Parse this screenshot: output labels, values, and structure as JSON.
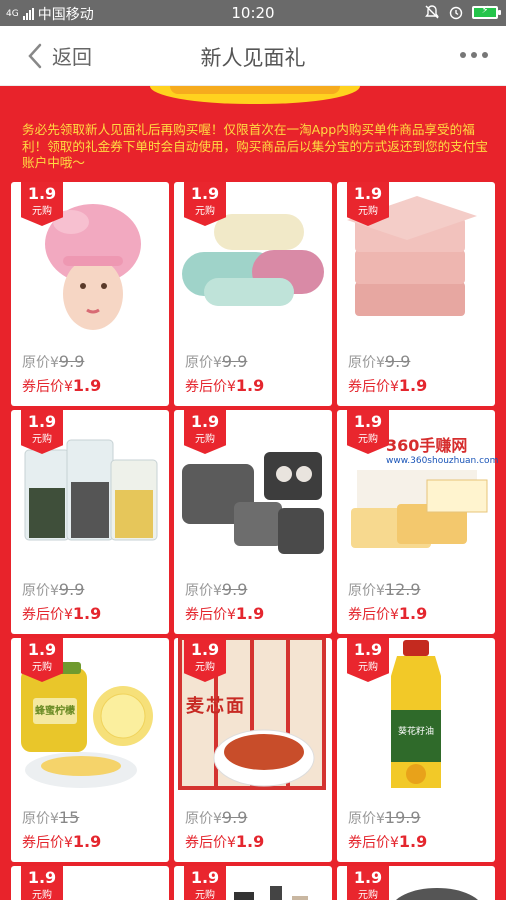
{
  "status": {
    "carrier": "中国移动",
    "time": "10:20",
    "net_label": "4G",
    "battery_icon": "battery-charging-icon"
  },
  "nav": {
    "back_label": "返回",
    "title": "新人见面礼",
    "more_icon": "more-dots-icon"
  },
  "notice": "务必先领取新人见面礼后再购买喔！仅限首次在一淘App内购买单件商品享受的福利！领取的礼金券下单时会自动使用，购买商品后以集分宝的方式返还到您的支付宝账户中哦～",
  "labels": {
    "orig_prefix": "原价¥",
    "now_prefix": "券后价¥",
    "badge_unit": "元购"
  },
  "products": [
    {
      "name": "shower-cap",
      "badge": "1.9",
      "orig": "9.9",
      "now": "1.9"
    },
    {
      "name": "towels",
      "badge": "1.9",
      "orig": "9.9",
      "now": "1.9"
    },
    {
      "name": "storage-boxes",
      "badge": "1.9",
      "orig": "9.9",
      "now": "1.9"
    },
    {
      "name": "grain-containers",
      "badge": "1.9",
      "orig": "9.9",
      "now": "1.9"
    },
    {
      "name": "baskets",
      "badge": "1.9",
      "orig": "9.9",
      "now": "1.9"
    },
    {
      "name": "bread-snack",
      "badge": "1.9",
      "orig": "12.9",
      "now": "1.9"
    },
    {
      "name": "honey-lemon-tea",
      "badge": "1.9",
      "orig": "15",
      "now": "1.9"
    },
    {
      "name": "wheat-noodles",
      "badge": "1.9",
      "orig": "9.9",
      "now": "1.9"
    },
    {
      "name": "sunflower-oil",
      "badge": "1.9",
      "orig": "19.9",
      "now": "1.9"
    },
    {
      "name": "partial-1",
      "badge": "1.9"
    },
    {
      "name": "partial-2",
      "badge": "1.9"
    },
    {
      "name": "partial-3",
      "badge": "1.9"
    }
  ],
  "product_text": {
    "noodle_brand": "麦芯面",
    "tea_label": "蜂蜜柠檬",
    "oil_label": "葵花籽油"
  },
  "watermark": {
    "line1": "360手赚网",
    "line2": "www.360shouzhuan.com"
  },
  "colors": {
    "primary": "#e8232b",
    "badge": "#e9262e",
    "price": "#e4262e",
    "notice": "#ffdc42"
  }
}
